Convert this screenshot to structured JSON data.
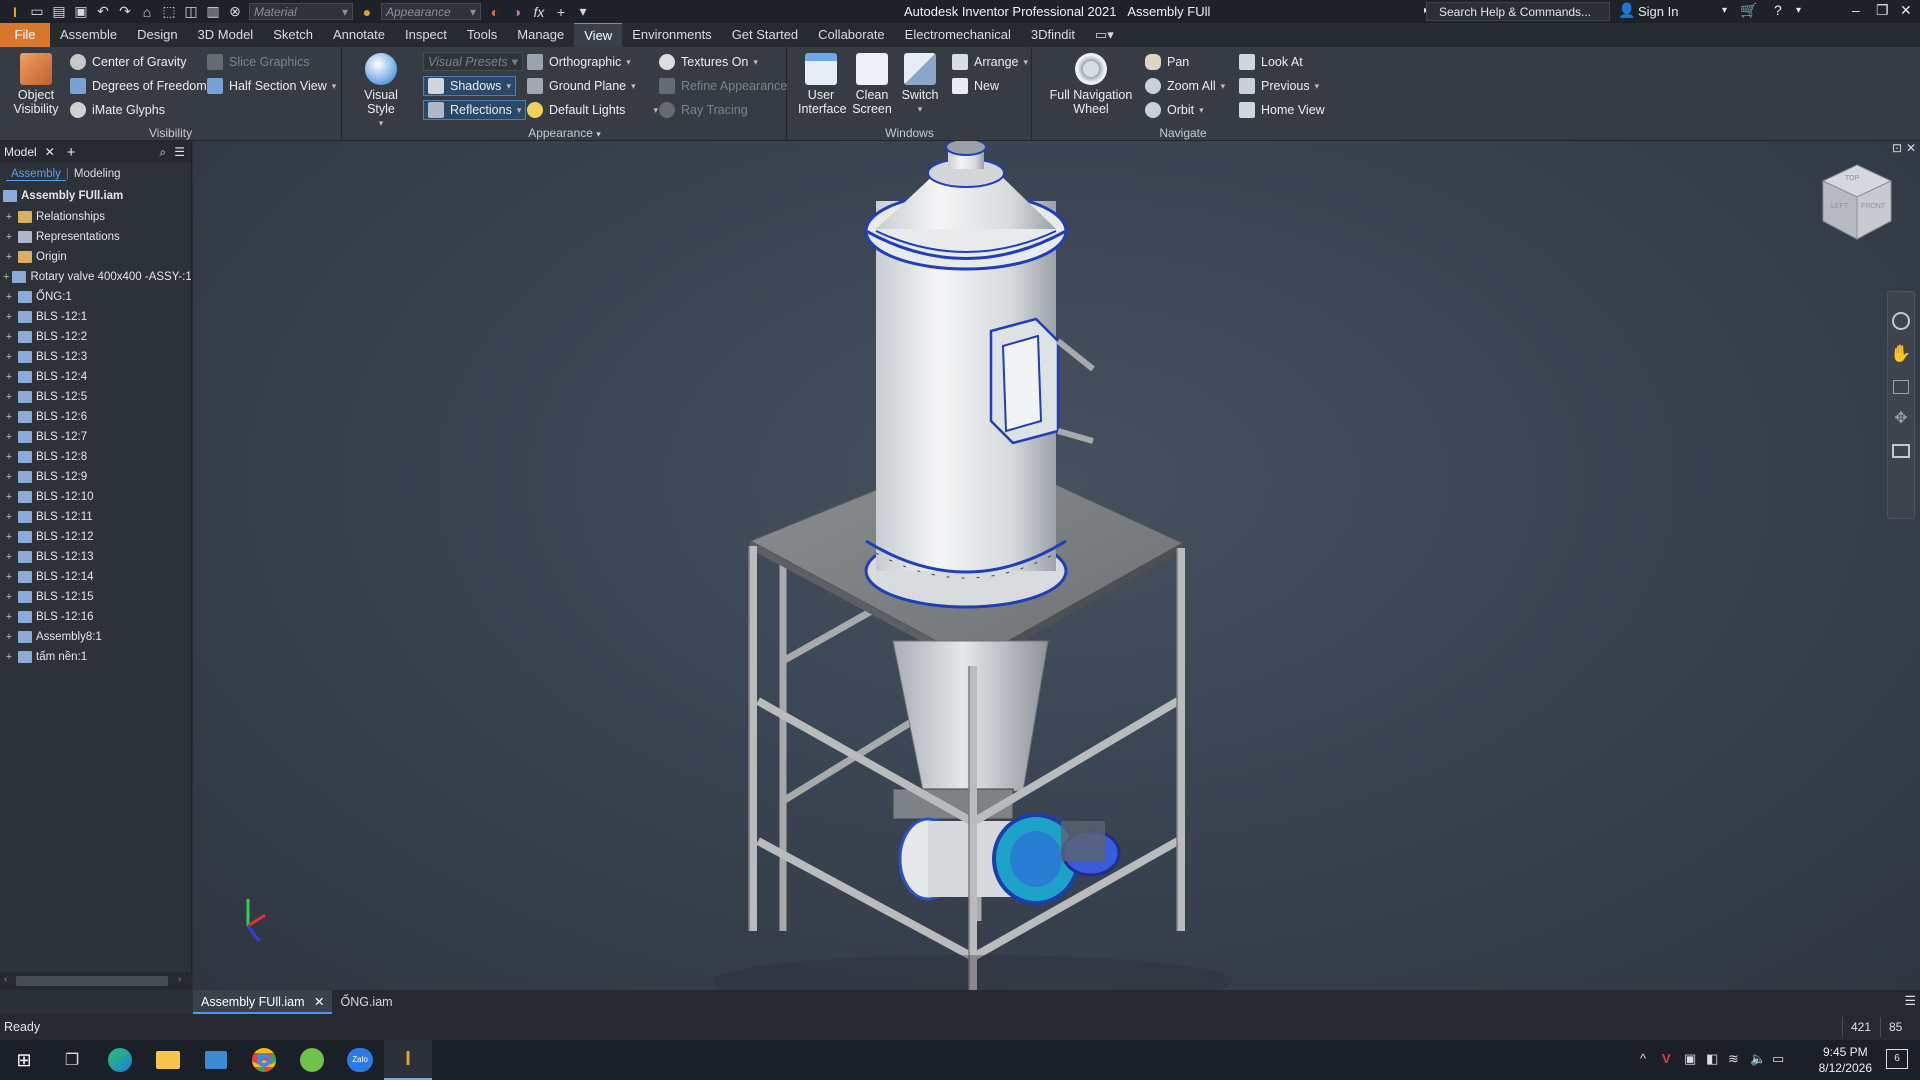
{
  "titlebar": {
    "app_title": "Autodesk Inventor Professional 2021",
    "doc_title": "Assembly FUll",
    "material_placeholder": "Material",
    "appearance_placeholder": "Appearance",
    "search": "Search Help & Commands...",
    "sign_in": "Sign In"
  },
  "menu": {
    "tabs": [
      "File",
      "Assemble",
      "Design",
      "3D Model",
      "Sketch",
      "Annotate",
      "Inspect",
      "Tools",
      "Manage",
      "View",
      "Environments",
      "Get Started",
      "Collaborate",
      "Electromechanical",
      "3Dfindit"
    ],
    "active": "View"
  },
  "ribbon": {
    "visibility": {
      "label": "Visibility",
      "object_visibility": "Object\nVisibility",
      "center_of_gravity": "Center of Gravity",
      "degrees_of_freedom": "Degrees of Freedom",
      "imate_glyphs": "iMate Glyphs",
      "slice_graphics": "Slice Graphics",
      "half_section_view": "Half Section View"
    },
    "appearance": {
      "label": "Appearance",
      "visual_style": "Visual Style",
      "visual_presets": "Visual Presets",
      "shadows": "Shadows",
      "reflections": "Reflections",
      "orthographic": "Orthographic",
      "ground_plane": "Ground Plane",
      "default_lights": "Default Lights",
      "textures_on": "Textures On",
      "refine_appearance": "Refine Appearance",
      "ray_tracing": "Ray Tracing"
    },
    "windows": {
      "label": "Windows",
      "user_interface": "User\nInterface",
      "clean_screen": "Clean\nScreen",
      "switch": "Switch",
      "arrange": "Arrange",
      "new": "New"
    },
    "navigate": {
      "label": "Navigate",
      "full_nav_wheel": "Full Navigation\nWheel",
      "pan": "Pan",
      "zoom_all": "Zoom All",
      "orbit": "Orbit",
      "look_at": "Look At",
      "previous": "Previous",
      "home_view": "Home View"
    }
  },
  "browser": {
    "tab": "Model",
    "subtabs": [
      "Assembly",
      "Modeling"
    ],
    "root": "Assembly FUll.iam",
    "nodes": [
      "Relationships",
      "Representations",
      "Origin",
      "Rotary valve 400x400 -ASSY-:1",
      "ỐNG:1",
      "BLS -12:1",
      "BLS -12:2",
      "BLS -12:3",
      "BLS -12:4",
      "BLS -12:5",
      "BLS -12:6",
      "BLS -12:7",
      "BLS -12:8",
      "BLS -12:9",
      "BLS -12:10",
      "BLS -12:11",
      "BLS -12:12",
      "BLS -12:13",
      "BLS -12:14",
      "BLS -12:15",
      "BLS -12:16",
      "Assembly8:1",
      "tấm nền:1"
    ]
  },
  "viewcube": {
    "face_top": "TOP",
    "face_left": "LEFT",
    "face_front": "FRONT"
  },
  "doc_tabs": [
    "Assembly FUll.iam",
    "ỐNG.iam"
  ],
  "status": {
    "text": "Ready",
    "num1": "421",
    "num2": "85"
  },
  "clock": {
    "time": "9:45 PM",
    "date": "8/12/2026"
  },
  "tray": {
    "notifications": "6"
  }
}
